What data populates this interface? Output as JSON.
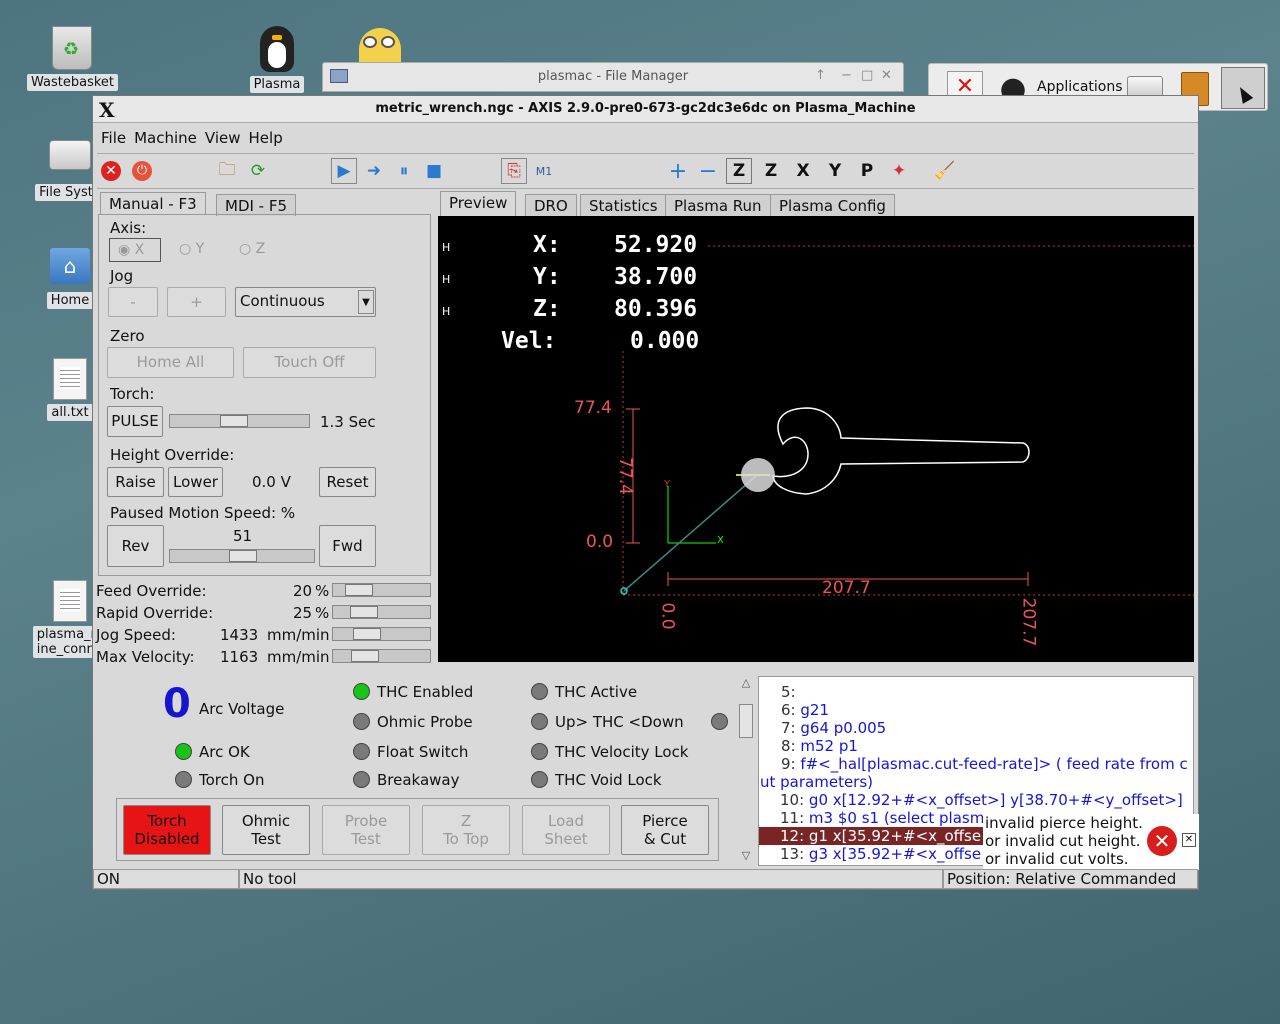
{
  "desktop": {
    "icons": [
      {
        "label": "Wastebasket"
      },
      {
        "label": "Plasma"
      },
      {
        "label": "File Syste"
      },
      {
        "label": "Home"
      },
      {
        "label": "all.txt"
      },
      {
        "label": "plasma_m\nine_conne"
      }
    ]
  },
  "file_manager": {
    "title": "plasmac - File Manager"
  },
  "panel": {
    "applications_label": "Applications"
  },
  "window": {
    "title": "metric_wrench.ngc - AXIS 2.9.0-pre0-673-gc2dc3e6dc on Plasma_Machine"
  },
  "menu": [
    "File",
    "Machine",
    "View",
    "Help"
  ],
  "left_tabs": [
    "Manual - F3",
    "MDI - F5"
  ],
  "axis": {
    "label": "Axis:",
    "options": [
      "X",
      "Y",
      "Z"
    ],
    "selected": "X"
  },
  "jog": {
    "label": "Jog",
    "minus": "-",
    "plus": "+",
    "mode": "Continuous"
  },
  "zero": {
    "label": "Zero",
    "home_all": "Home All",
    "touch_off": "Touch Off"
  },
  "torch": {
    "label": "Torch:",
    "pulse": "PULSE",
    "value": "1.3 Sec",
    "slider_level": 0.45
  },
  "height_override": {
    "label": "Height Override:",
    "raise": "Raise",
    "lower": "Lower",
    "value": "0.0 V",
    "reset": "Reset"
  },
  "paused_motion": {
    "label": "Paused Motion Speed: %",
    "rev": "Rev",
    "fwd": "Fwd",
    "value": "51",
    "slider_level": 0.51
  },
  "overrides": [
    {
      "label": "Feed Override:",
      "value": "20",
      "unit": "%"
    },
    {
      "label": "Rapid Override:",
      "value": "25",
      "unit": "%"
    },
    {
      "label": "Jog Speed:",
      "value": "1433",
      "unit": "mm/min"
    },
    {
      "label": "Max Velocity:",
      "value": "1163",
      "unit": "mm/min"
    }
  ],
  "right_tabs": [
    "Preview",
    "DRO",
    "Statistics",
    "Plasma Run",
    "Plasma Config"
  ],
  "dro": {
    "x_label": "X:",
    "x": "52.920",
    "y_label": "Y:",
    "y": "38.700",
    "z_label": "Z:",
    "z": "80.396",
    "vel_label": "Vel:",
    "vel": "0.000",
    "homed": "H"
  },
  "preview": {
    "y_max": "77.4",
    "y_mid": "77.4",
    "y_zero": "0.0",
    "x_len": "207.7",
    "x_zero": "0.0",
    "x_end": "207.7",
    "axis_x": "X",
    "axis_y": "Y"
  },
  "arc": {
    "voltage": "0",
    "voltage_label": "Arc Voltage",
    "arc_ok": "Arc OK",
    "torch_on": "Torch On"
  },
  "indicators": {
    "thc_enabled": "THC Enabled",
    "ohmic_probe": "Ohmic Probe",
    "float_switch": "Float Switch",
    "breakaway": "Breakaway",
    "thc_active": "THC Active",
    "up_down": "Up> THC <Down",
    "thc_velocity_lock": "THC Velocity Lock",
    "thc_void_lock": "THC Void Lock"
  },
  "buttons": {
    "torch_disabled": [
      "Torch",
      "Disabled"
    ],
    "ohmic_test": [
      "Ohmic",
      "Test"
    ],
    "probe_test": [
      "Probe",
      "Test"
    ],
    "z_to_top": [
      "Z",
      "To Top"
    ],
    "load_sheet": [
      "Load",
      "Sheet"
    ],
    "pierce_cut": [
      "Pierce",
      "& Cut"
    ]
  },
  "gcode": [
    {
      "n": "5:",
      "text": ""
    },
    {
      "n": "6:",
      "text": "g21"
    },
    {
      "n": "7:",
      "text": "g64 p0.005"
    },
    {
      "n": "8:",
      "text": "m52 p1"
    },
    {
      "n": "9:",
      "text": "f#<_hal[plasmac.cut-feed-rate]> ( feed rate from c"
    },
    {
      "n": "",
      "text": "ut parameters)"
    },
    {
      "n": "10:",
      "text": "g0 x[12.92+#<x_offset>] y[38.70+#<y_offset>]"
    },
    {
      "n": "11:",
      "text": "m3 $0 s1 (select plasm"
    },
    {
      "n": "12:",
      "text": "g1 x[35.92+#<x_offse"
    },
    {
      "n": "13:",
      "text": "g3 x[35.92+#<x_offse"
    }
  ],
  "error": {
    "lines": [
      "invalid pierce height.",
      "or invalid cut height.",
      "or invalid cut volts."
    ]
  },
  "statusbar": {
    "state": "ON",
    "tool": "No tool",
    "position": "Position: Relative Commanded"
  }
}
